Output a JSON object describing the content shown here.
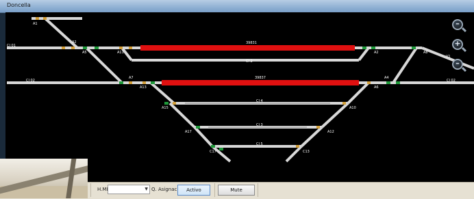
{
  "window": {
    "title": "Doncella"
  },
  "tracks": {
    "labels": {
      "a1": "A1",
      "a2": "A2",
      "a3": "A3",
      "a5": "A5",
      "a6": "A6",
      "a7": "A7",
      "a8": "A8",
      "a9": "A9",
      "a10": "A10",
      "a11": "A11",
      "a12": "A12",
      "a13": "A13",
      "a15": "A15",
      "a17": "A17",
      "a4": "A4",
      "c13": "C13",
      "c17": "C17",
      "ci1_left": "CI 01",
      "ci2": "CI 2",
      "ci1_mid": "CI 02",
      "ci1_right": "CI 02",
      "ci4": "CI 4",
      "ci3": "CI 3",
      "ci5": "CI 5",
      "red1": "39831",
      "red2": "39837",
      "right_top": "V1"
    }
  },
  "toolbar": {
    "hmi_label": "H.MI:",
    "hmi_value": "",
    "asignacion_label": "Q. Asignación",
    "activo_label": "Activo",
    "mute_label": "Mute"
  },
  "zoom": {
    "out_top": "–",
    "in": "+",
    "out": "–"
  }
}
